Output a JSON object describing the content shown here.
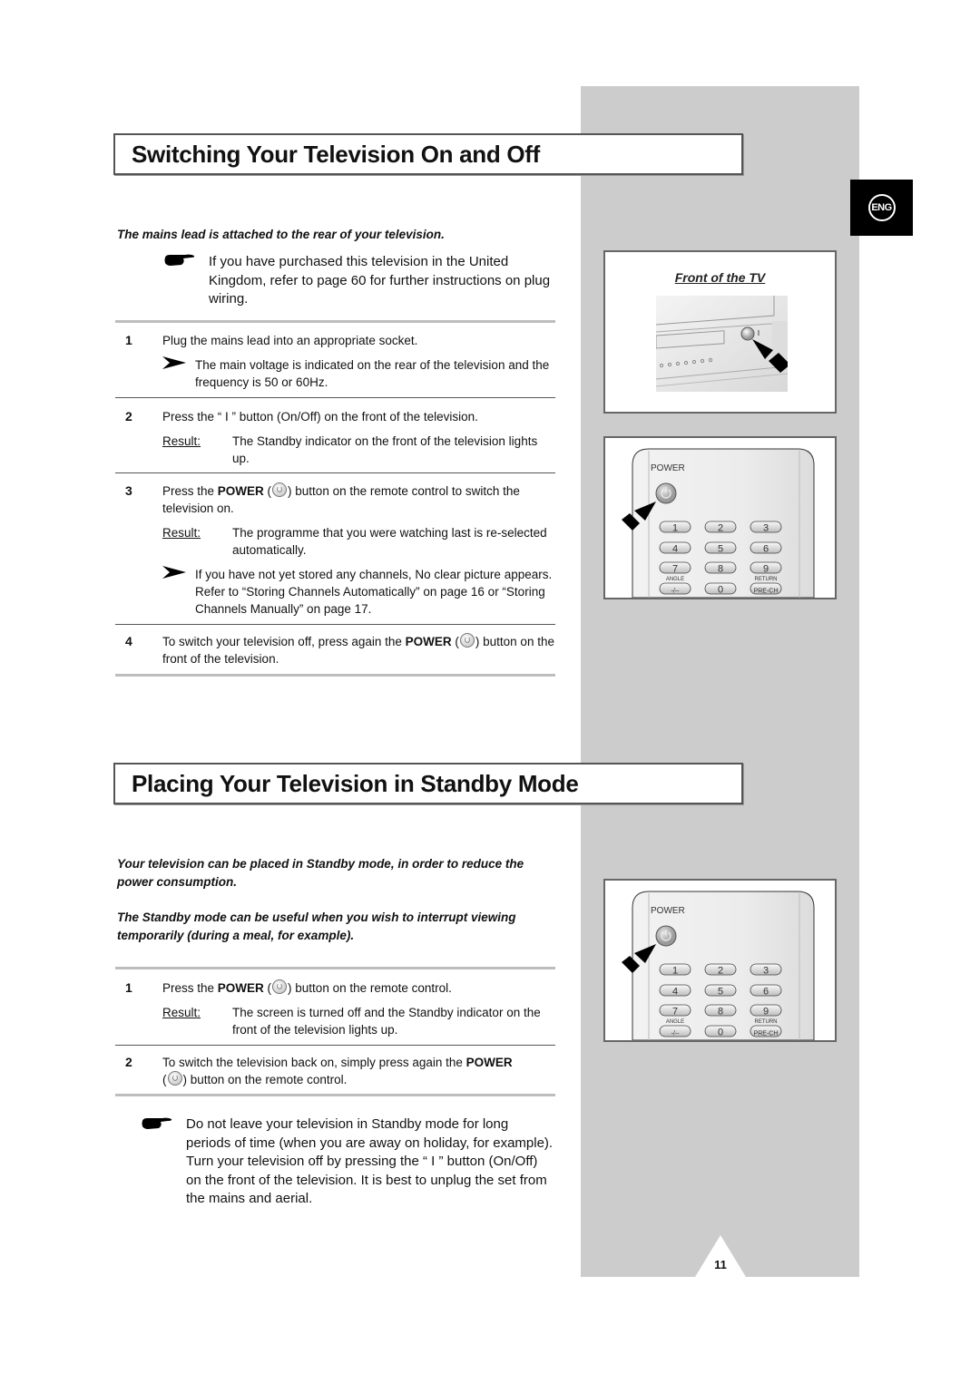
{
  "side_tab": {
    "language": "ENG",
    "icon": "language-badge"
  },
  "page_number": "11",
  "section1": {
    "title": "Switching Your Television On and Off",
    "intro": "The mains lead is attached to the rear of your television.",
    "note_icon": "pointing-hand",
    "note": "If you have purchased this television in the United Kingdom, refer to page 60 for further instructions on plug wiring.",
    "steps": [
      {
        "number": "1",
        "text": "Plug the mains lead into an appropriate socket.",
        "tip": "The main voltage is indicated on the rear of the television and the frequency is 50 or 60Hz."
      },
      {
        "number": "2",
        "text": "Press the “ I ” button (On/Off) on the front of the television.",
        "result_label": "Result:",
        "result": "The Standby indicator on the front of the television lights up."
      },
      {
        "number": "3",
        "text_before": "Press the ",
        "bold": "POWER",
        "text_after": ") button on the remote control to switch the television on.",
        "result_label": "Result:",
        "result": "The programme that you were watching last is re-selected automatically.",
        "tip": "If you have not yet stored any channels, No clear picture appears. Refer to “Storing Channels Automatically” on page 16 or “Storing Channels Manually” on page 17."
      },
      {
        "number": "4",
        "text_before": "To switch your television off, press again the ",
        "bold": "POWER",
        "text_after": ") button on the front of the television."
      }
    ]
  },
  "section2": {
    "title": "Placing Your Television in Standby Mode",
    "intro1": "Your television can be placed in Standby mode, in order to reduce the power consumption.",
    "intro2": "The Standby mode can be useful when you wish to interrupt viewing temporarily (during a meal, for example).",
    "steps": [
      {
        "number": "1",
        "text_before": "Press the ",
        "bold": "POWER",
        "text_after": ") button on the remote control.",
        "result_label": "Result:",
        "result": "The screen is turned off and the Standby indicator on the front of the television lights up."
      },
      {
        "number": "2",
        "text_before": "To switch the television back on, simply press again the ",
        "bold": "POWER",
        "text_after": ") button on the remote control."
      }
    ],
    "note_icon": "pointing-hand",
    "note": "Do not leave your television in Standby mode for long periods of time (when you are away on holiday, for example). Turn your television off by pressing the “ I ” button (On/Off) on the front of the television. It is best to unplug the set from the mains and aerial."
  },
  "figures": {
    "tv_front": {
      "caption": "Front of the TV",
      "button_label": "I"
    },
    "remote": {
      "power_label": "POWER",
      "keys": [
        "1",
        "2",
        "3",
        "4",
        "5",
        "6",
        "7",
        "8",
        "9",
        "-/--",
        "0",
        "PRE-CH"
      ],
      "angle_label": "ANGLE",
      "return_label": "RETURN"
    }
  }
}
